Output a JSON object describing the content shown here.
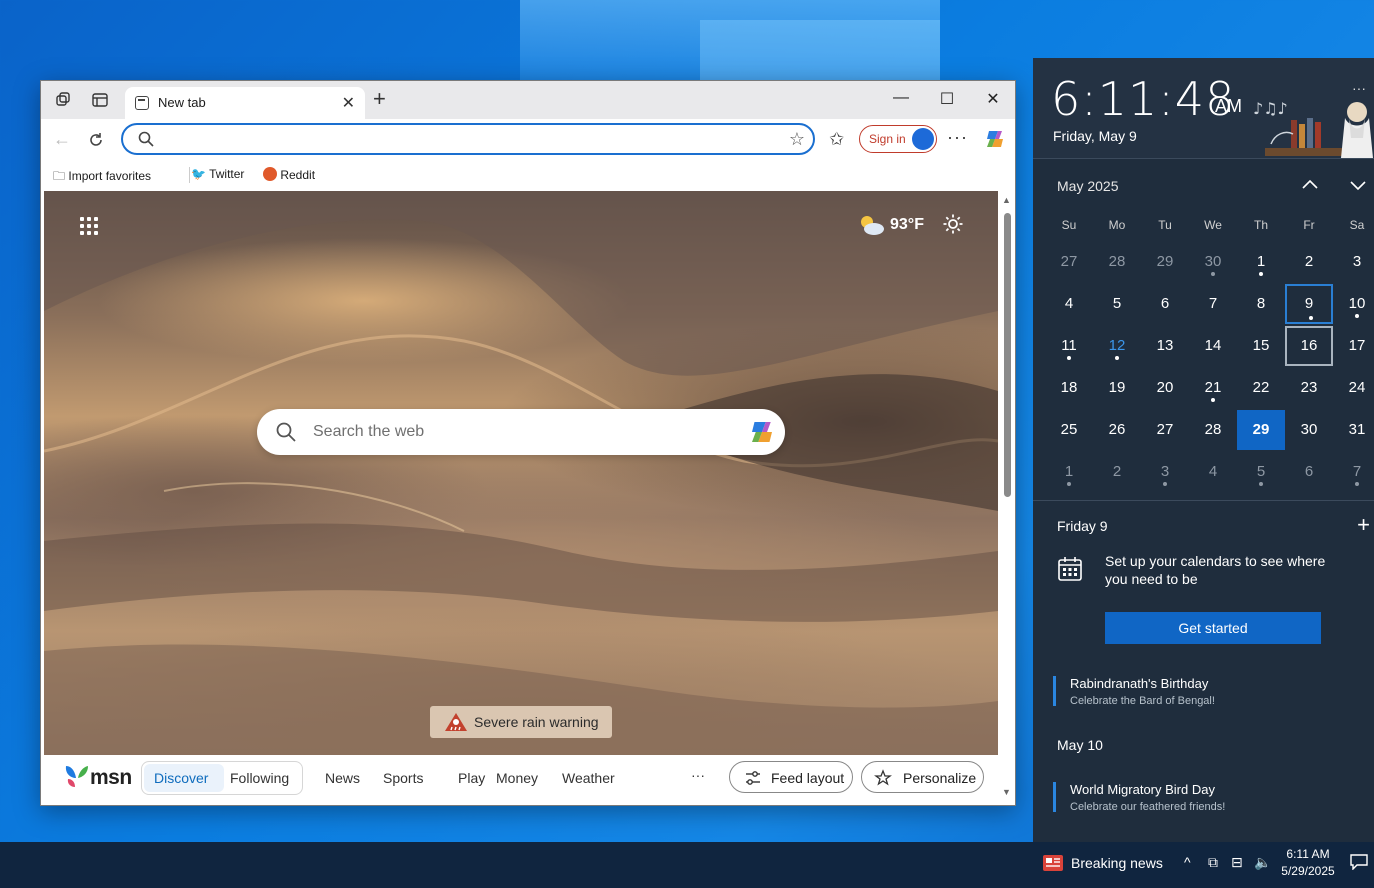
{
  "browser": {
    "tab_title": "New tab",
    "address_placeholder": "",
    "signin_label": "Sign in",
    "bookmarks": [
      {
        "label": "Import favorites",
        "icon": "import-favorites-icon"
      },
      {
        "label": "Twitter",
        "icon": "twitter-icon"
      },
      {
        "label": "Reddit",
        "icon": "reddit-icon"
      }
    ]
  },
  "ntp": {
    "weather_temp": "93°F",
    "search_placeholder": "Search the web",
    "alert": "Severe rain warning"
  },
  "msn": {
    "logo_text": "msn",
    "tabs": [
      "Discover",
      "Following"
    ],
    "categories": [
      "News",
      "Sports",
      "Play",
      "Money",
      "Weather"
    ],
    "more": "···",
    "feed_layout": "Feed layout",
    "personalize": "Personalize"
  },
  "calendar": {
    "time": "6:11:48",
    "ampm": "AM",
    "date_long": "Friday, May 9",
    "more": "···",
    "month_title": "May 2025",
    "weekdays": [
      "Su",
      "Mo",
      "Tu",
      "We",
      "Th",
      "Fr",
      "Sa"
    ],
    "weeks": [
      [
        "27",
        "28",
        "29",
        "30",
        "1",
        "2",
        "3"
      ],
      [
        "4",
        "5",
        "6",
        "7",
        "8",
        "9",
        "10"
      ],
      [
        "11",
        "12",
        "13",
        "14",
        "15",
        "16",
        "17"
      ],
      [
        "18",
        "19",
        "20",
        "21",
        "22",
        "23",
        "24"
      ],
      [
        "25",
        "26",
        "27",
        "28",
        "29",
        "30",
        "31"
      ],
      [
        "1",
        "2",
        "3",
        "4",
        "5",
        "6",
        "7"
      ]
    ],
    "today": "29",
    "selected": "9"
  },
  "agenda": {
    "day1": "Friday 9",
    "setup_text": "Set up your calendars to see where you need to be",
    "get_started": "Get started",
    "event1_title": "Rabindranath's Birthday",
    "event1_sub": "Celebrate the Bard of Bengal!",
    "day2": "May 10",
    "event2_title": "World Migratory Bird Day",
    "event2_sub": "Celebrate our feathered friends!"
  },
  "taskbar": {
    "news": "Breaking news",
    "time": "6:11 AM",
    "date": "5/29/2025"
  },
  "colors": {
    "accent": "#1066c5",
    "flyout_bg": "#1f2d3d",
    "taskbar_bg": "#10253f",
    "signin_red": "#c03b2b"
  }
}
